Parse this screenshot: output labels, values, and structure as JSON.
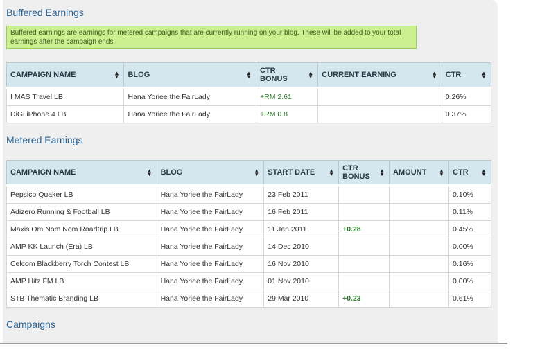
{
  "buffered": {
    "title": "Buffered Earnings",
    "notice": "Buffered earnings are earnings for metered campaigns that are currently running on your blog. These will be added to your total earnings after the campaign ends",
    "columns": [
      "CAMPAIGN NAME",
      "BLOG",
      "CTR BONUS",
      "CURRENT EARNING",
      "CTR"
    ],
    "rows": [
      {
        "campaign": "I MAS Travel LB",
        "blog": "Hana Yoriee the FairLady",
        "bonus": "+RM 2.61",
        "earning": "",
        "ctr": "0.26%"
      },
      {
        "campaign": "DiGi iPhone 4 LB",
        "blog": "Hana Yoriee the FairLady",
        "bonus": "+RM 0.8",
        "earning": "",
        "ctr": "0.37%"
      }
    ]
  },
  "metered": {
    "title": "Metered Earnings",
    "columns": [
      "CAMPAIGN NAME",
      "BLOG",
      "START DATE",
      "CTR BONUS",
      "AMOUNT",
      "CTR"
    ],
    "rows": [
      {
        "campaign": "Pepsico Quaker LB",
        "blog": "Hana Yoriee the FairLady",
        "start": "23 Feb 2011",
        "bonus": "",
        "amount": "",
        "ctr": "0.10%"
      },
      {
        "campaign": "Adizero Running & Football LB",
        "blog": "Hana Yoriee the FairLady",
        "start": "16 Feb 2011",
        "bonus": "",
        "amount": "",
        "ctr": "0.11%"
      },
      {
        "campaign": "Maxis Om Nom Nom Roadtrip LB",
        "blog": "Hana Yoriee the FairLady",
        "start": "11 Jan 2011",
        "bonus": "+0.28",
        "amount": "",
        "ctr": "0.45%"
      },
      {
        "campaign": "AMP KK Launch (Era) LB",
        "blog": "Hana Yoriee the FairLady",
        "start": "14 Dec 2010",
        "bonus": "",
        "amount": "",
        "ctr": "0.00%"
      },
      {
        "campaign": "Celcom Blackberry Torch Contest LB",
        "blog": "Hana Yoriee the FairLady",
        "start": "16 Nov 2010",
        "bonus": "",
        "amount": "",
        "ctr": "0.16%"
      },
      {
        "campaign": "AMP Hitz.FM LB",
        "blog": "Hana Yoriee the FairLady",
        "start": "01 Nov 2010",
        "bonus": "",
        "amount": "",
        "ctr": "0.00%"
      },
      {
        "campaign": "STB Thematic Branding LB",
        "blog": "Hana Yoriee the FairLady",
        "start": "29 Mar 2010",
        "bonus": "+0.23",
        "amount": "",
        "ctr": "0.61%"
      }
    ]
  },
  "campaigns": {
    "title": "Campaigns"
  },
  "icons": {
    "sort": "sort-arrows-icon"
  },
  "colors": {
    "header_bg": "#d5e7ee",
    "notice_bg": "#ccf090",
    "title": "#2a6496",
    "bonus": "#2b7a2b"
  }
}
